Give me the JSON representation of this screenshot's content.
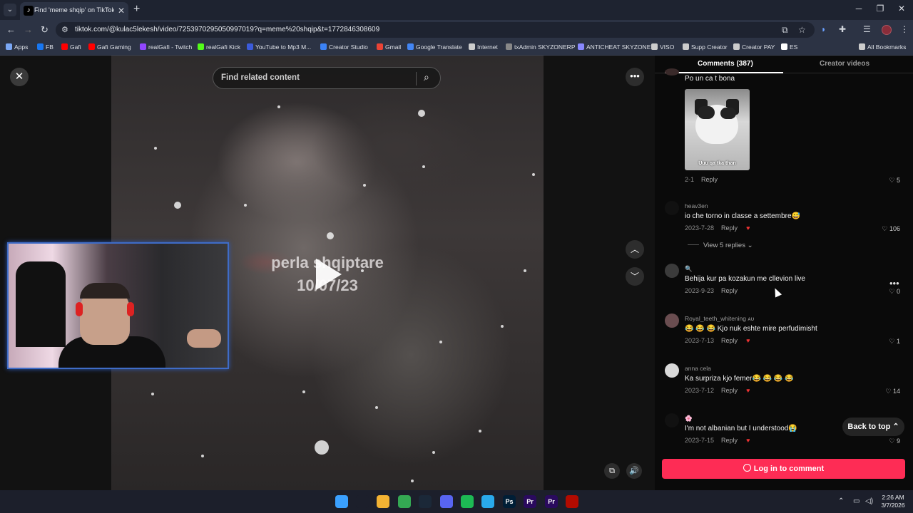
{
  "browser": {
    "tab_title": "Find 'meme shqip' on TikTok | T",
    "tab_icon": "tiktok-icon",
    "url": "tiktok.com/@kulac5lekesh/video/7253970295050997019?q=meme%20shqip&t=1772846308609"
  },
  "bookmarks": [
    {
      "label": "Apps",
      "color": "#7aa7f5"
    },
    {
      "label": "FB",
      "color": "#1877f2"
    },
    {
      "label": "Gafi",
      "color": "#ff0000"
    },
    {
      "label": "Gafi Gaming",
      "color": "#ff0000"
    },
    {
      "label": "realGafi - Twitch",
      "color": "#9146ff"
    },
    {
      "label": "realGafi Kick",
      "color": "#53fc18"
    },
    {
      "label": "YouTube to Mp3 M...",
      "color": "#3b5bdb"
    },
    {
      "label": "Creator Studio",
      "color": "#3b82f6"
    },
    {
      "label": "Gmail",
      "color": "#ea4335"
    },
    {
      "label": "Google Translate",
      "color": "#4285f4"
    },
    {
      "label": "Internet",
      "color": "#cccccc"
    },
    {
      "label": "txAdmin SKYZONERP",
      "color": "#888888"
    },
    {
      "label": "ANTICHEAT SKYZONE",
      "color": "#8888ff"
    },
    {
      "label": "VISO",
      "color": "#cccccc"
    },
    {
      "label": "Supp Creator",
      "color": "#cccccc"
    },
    {
      "label": "Creator PAY",
      "color": "#cccccc"
    },
    {
      "label": "ES",
      "color": "#ffffff"
    },
    {
      "label": "All Bookmarks",
      "color": "#cccccc"
    }
  ],
  "player": {
    "search_placeholder": "Find related content",
    "caption_line1": "perla shqiptare",
    "caption_line2": "10/07/23"
  },
  "comments_panel": {
    "tab_comments": "Comments (387)",
    "tab_creator": "Creator videos",
    "top_comment": {
      "text": "Po un ca t bona",
      "meme_caption": "Uuu qa tka than",
      "date": "2-1",
      "reply": "Reply",
      "likes": "5"
    },
    "comments": [
      {
        "user": "heav3en",
        "text": "io che torno in classe a settembre😅",
        "date": "2023-7-28",
        "reply": "Reply",
        "likes": "106",
        "views": "View 5 replies"
      },
      {
        "user": "🔍",
        "text": "Behija kur pa kozakun me cllevion live",
        "date": "2023-9-23",
        "reply": "Reply",
        "likes": "0"
      },
      {
        "user": "Royal_teeth_whitening ᴀᴜ",
        "text": "😂 😂 😂 Kjo nuk eshte mire perfudimisht",
        "date": "2023-7-13",
        "reply": "Reply",
        "likes": "1"
      },
      {
        "user": "anna cela",
        "text": "Ka surpriza kjo femer😂 😂 😂 😂",
        "date": "2023-7-12",
        "reply": "Reply",
        "likes": "14"
      },
      {
        "user": "🌸",
        "text": "I'm not albanian but I understood😭",
        "date": "2023-7-15",
        "reply": "Reply",
        "likes": "9"
      }
    ],
    "back_to_top": "Back to top ⌃",
    "login_button": "Log in to comment",
    "accent": "#fe2c55"
  },
  "taskbar": {
    "time": "2:26 AM",
    "date": "3/7/2026",
    "apps": [
      {
        "label": "",
        "icon": "windows-icon",
        "color": "#3aa0ff"
      },
      {
        "label": "",
        "icon": "search-icon",
        "color": "#1c1f2b"
      },
      {
        "label": "",
        "icon": "folder-icon",
        "color": "#f2b233"
      },
      {
        "label": "",
        "icon": "chrome-icon",
        "color": "#34a853"
      },
      {
        "label": "",
        "icon": "steam-icon",
        "color": "#1b2838"
      },
      {
        "label": "",
        "icon": "discord-icon",
        "color": "#5865f2"
      },
      {
        "label": "",
        "icon": "spotify-icon",
        "color": "#1db954"
      },
      {
        "label": "",
        "icon": "telegram-icon",
        "color": "#29a9eb"
      },
      {
        "label": "Ps",
        "icon": "photoshop-icon",
        "color": "#001e36"
      },
      {
        "label": "Pr",
        "icon": "premiere-icon",
        "color": "#2a0a5e"
      },
      {
        "label": "Pr",
        "icon": "premiere-icon",
        "color": "#2a0a5e"
      },
      {
        "label": "",
        "icon": "acrobat-icon",
        "color": "#b30b00"
      }
    ]
  }
}
